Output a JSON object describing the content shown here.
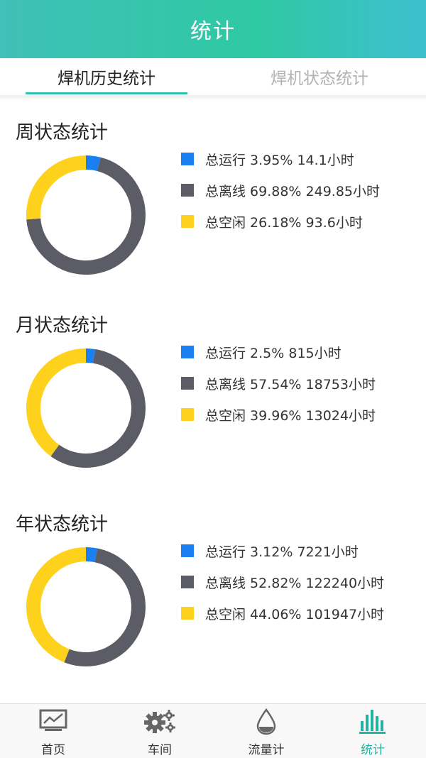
{
  "header": {
    "title": "统计"
  },
  "tabs": [
    {
      "label": "焊机历史统计",
      "active": true
    },
    {
      "label": "焊机状态统计",
      "active": false
    }
  ],
  "colors": {
    "running": "#1a7ff0",
    "offline": "#5c5c66",
    "idle": "#fed11d",
    "accent": "#2fc1b4"
  },
  "sections": [
    {
      "title": "周状态统计",
      "legend": [
        "总运行 3.95% 14.1小时",
        "总离线 69.88% 249.85小时",
        "总空闲 26.18% 93.6小时"
      ]
    },
    {
      "title": "月状态统计",
      "legend": [
        "总运行 2.5% 815小时",
        "总离线 57.54% 18753小时",
        "总空闲 39.96% 13024小时"
      ]
    },
    {
      "title": "年状态统计",
      "legend": [
        "总运行 3.12% 7221小时",
        "总离线 52.82% 122240小时",
        "总空闲 44.06% 101947小时"
      ]
    }
  ],
  "chart_data": [
    {
      "type": "pie",
      "categories": [
        "总运行",
        "总离线",
        "总空闲"
      ],
      "values": [
        3.95,
        69.88,
        26.18
      ],
      "title": "周状态统计"
    },
    {
      "type": "pie",
      "categories": [
        "总运行",
        "总离线",
        "总空闲"
      ],
      "values": [
        2.5,
        57.54,
        39.96
      ],
      "title": "月状态统计"
    },
    {
      "type": "pie",
      "categories": [
        "总运行",
        "总离线",
        "总空闲"
      ],
      "values": [
        3.12,
        52.82,
        44.06
      ],
      "title": "年状态统计"
    }
  ],
  "nav": [
    {
      "label": "首页",
      "icon": "chart-monitor-icon",
      "active": false
    },
    {
      "label": "车间",
      "icon": "gears-icon",
      "active": false
    },
    {
      "label": "流量计",
      "icon": "droplet-icon",
      "active": false
    },
    {
      "label": "统计",
      "icon": "bar-chart-icon",
      "active": true
    }
  ]
}
